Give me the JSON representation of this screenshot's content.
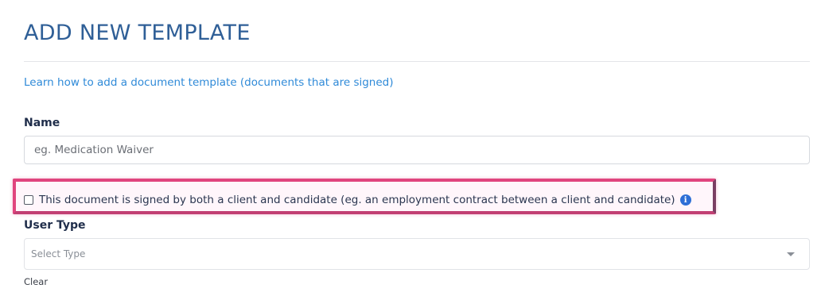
{
  "page": {
    "title": "ADD NEW TEMPLATE",
    "help_link": "Learn how to add a document template (documents that are signed)"
  },
  "form": {
    "name": {
      "label": "Name",
      "value": "",
      "placeholder": "eg. Medication Waiver"
    },
    "signed_by_both": {
      "label": "This document is signed by both a client and candidate (eg. an employment contract between a client and candidate)",
      "checked": false,
      "info_icon": "info-icon",
      "info_glyph": "i"
    },
    "user_type": {
      "label": "User Type",
      "placeholder": "Select Type",
      "dropdown_icon": "caret-down-icon",
      "clear_label": "Clear"
    }
  },
  "colors": {
    "title": "#2f5f97",
    "link": "#2f8ad8",
    "highlight": "#e0457e",
    "info_icon": "#2e6fd6"
  }
}
